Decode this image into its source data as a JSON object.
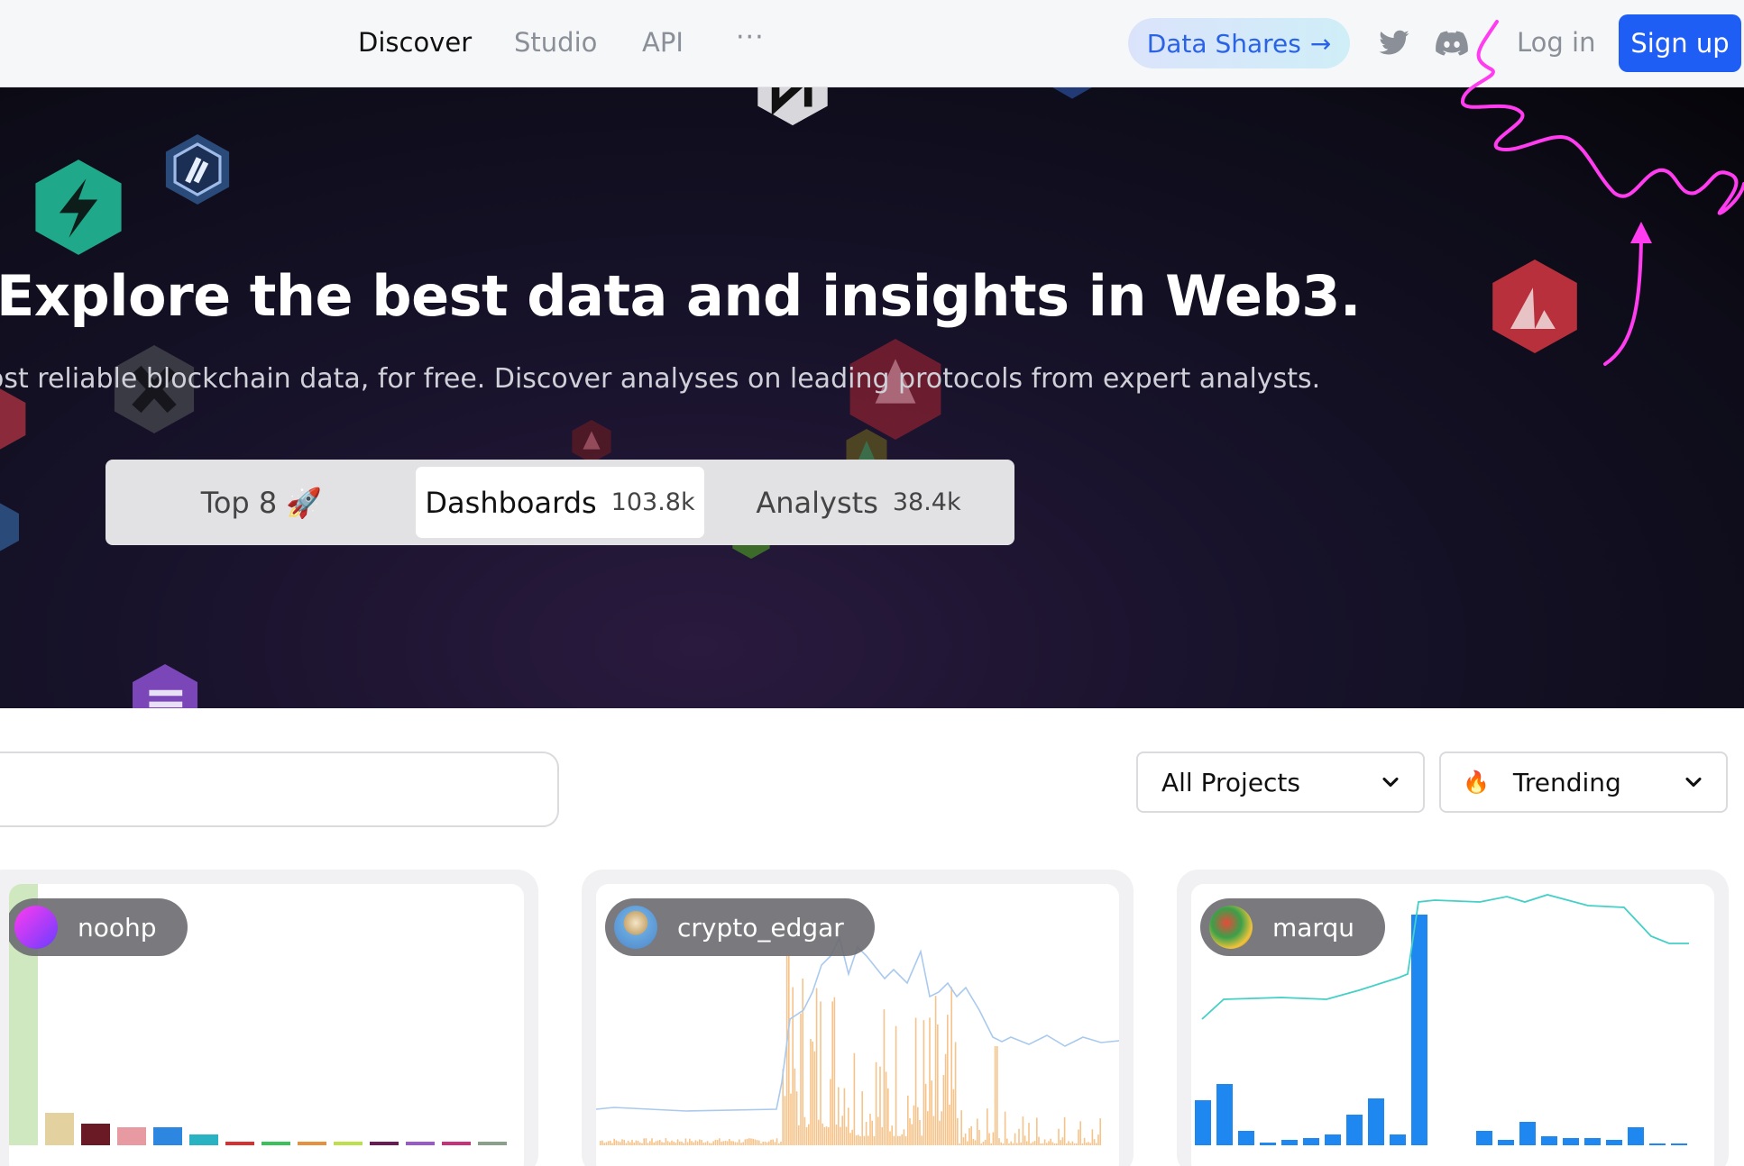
{
  "nav": {
    "links": [
      {
        "label": "Discover",
        "active": true
      },
      {
        "label": "Studio",
        "active": false
      },
      {
        "label": "API",
        "active": false
      }
    ],
    "more": "···",
    "data_shares": "Data Shares",
    "data_shares_arrow": "→",
    "twitter_icon": "twitter-icon",
    "discord_icon": "discord-icon",
    "login": "Log in",
    "signup": "Sign up"
  },
  "hero": {
    "title": "Explore the best data and insights in Web3.",
    "subtitle": "ost reliable blockchain data, for free. Discover analyses on leading protocols from expert analysts.",
    "tabs": [
      {
        "label": "Top 8 🚀",
        "count": "",
        "active": false
      },
      {
        "label": "Dashboards",
        "count": "103.8k",
        "active": true
      },
      {
        "label": "Analysts",
        "count": "38.4k",
        "active": false
      }
    ]
  },
  "filters": {
    "search_value": "",
    "projects": "All Projects",
    "sort_icon": "🔥",
    "sort": "Trending"
  },
  "colors": {
    "accent": "#1e5ef5",
    "annotation": "#ff3cf0"
  },
  "cards": [
    {
      "author": "noohp"
    },
    {
      "author": "crypto_edgar"
    },
    {
      "author": "marqu"
    }
  ]
}
